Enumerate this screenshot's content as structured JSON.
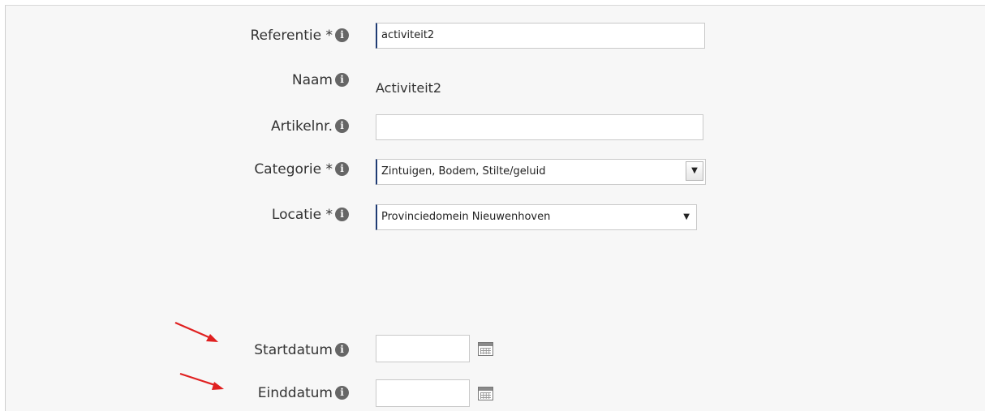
{
  "form": {
    "referentie": {
      "label": "Referentie *",
      "value": "activiteit2"
    },
    "naam": {
      "label": "Naam",
      "value": "Activiteit2"
    },
    "artikelnr": {
      "label": "Artikelnr.",
      "value": ""
    },
    "categorie": {
      "label": "Categorie *",
      "selected": "Zintuigen, Bodem, Stilte/geluid"
    },
    "locatie": {
      "label": "Locatie *",
      "selected": "Provinciedomein Nieuwenhoven"
    },
    "startdatum": {
      "label": "Startdatum",
      "value": ""
    },
    "einddatum": {
      "label": "Einddatum",
      "value": ""
    }
  },
  "icons": {
    "info": "info-icon",
    "calendar": "calendar-icon",
    "dropdown": "chevron-down-icon",
    "annotation": "red-arrow"
  },
  "glyphs": {
    "info": "i",
    "dropdown": "▼"
  },
  "colors": {
    "annotation_arrow": "#e02020",
    "info_icon": "#666666",
    "focus_bar": "#1f3b73"
  }
}
